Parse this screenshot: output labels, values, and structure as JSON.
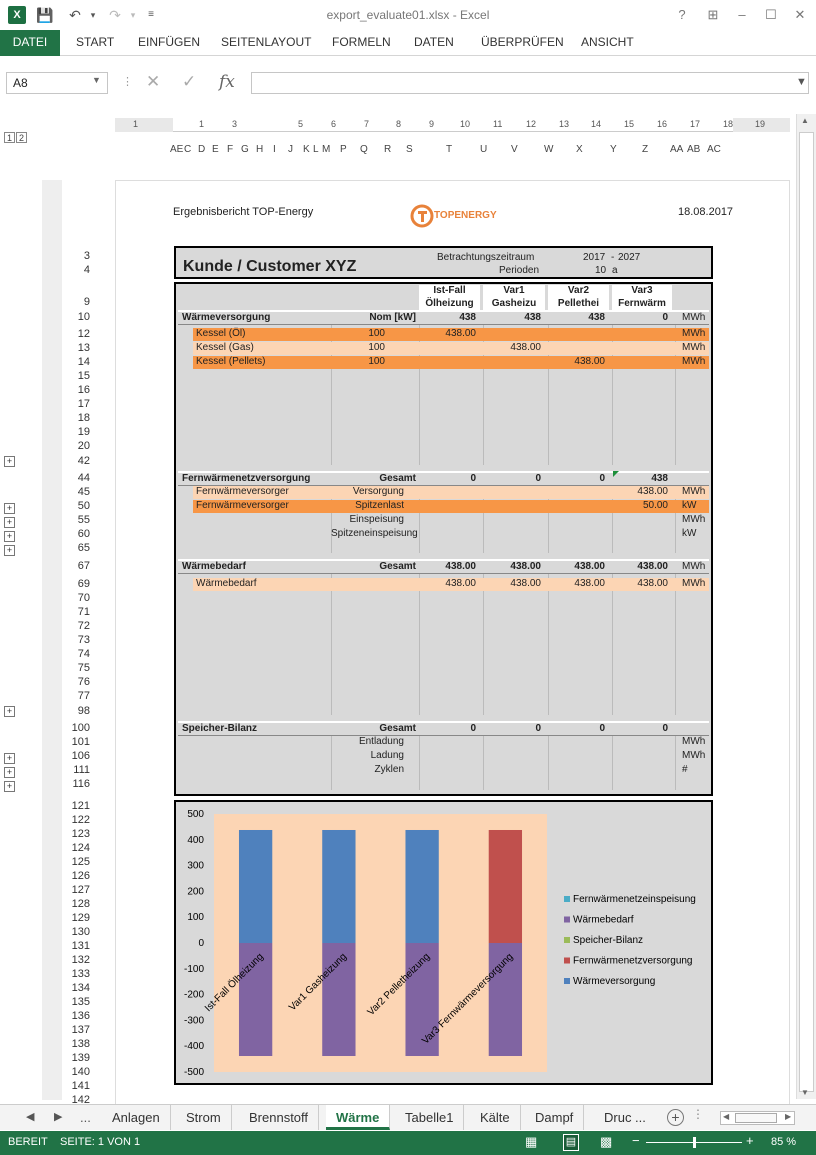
{
  "window": {
    "title": "export_evaluate01.xlsx - Excel",
    "app_icon": "X",
    "help": "?",
    "minimize": "–",
    "restore": "☐",
    "close": "✕"
  },
  "ribbon": {
    "tabs": [
      "DATEI",
      "START",
      "EINFÜGEN",
      "SEITENLAYOUT",
      "FORMELN",
      "DATEN",
      "ÜBERPRÜFEN",
      "ANSICHT"
    ],
    "active_tab": "DATEI"
  },
  "formula_bar": {
    "name_box": "A8",
    "fx_label": "fx",
    "formula": ""
  },
  "outline_levels": [
    "1",
    "2"
  ],
  "ruler": [
    "1",
    "1",
    "3",
    "5",
    "6",
    "7",
    "8",
    "9",
    "10",
    "11",
    "12",
    "13",
    "14",
    "15",
    "16",
    "17",
    "18",
    "19"
  ],
  "columns": [
    "AE",
    "C",
    "D",
    "E",
    "F",
    "G",
    "H",
    "I",
    "J",
    "K",
    "L",
    "M",
    "P",
    "Q",
    "R",
    "S",
    "T",
    "U",
    "V",
    "W",
    "X",
    "Y",
    "Z",
    "AA",
    "AB",
    "AC"
  ],
  "rows": [
    "3",
    "4",
    "9",
    "10",
    "12",
    "13",
    "14",
    "15",
    "16",
    "17",
    "18",
    "19",
    "20",
    "42",
    "44",
    "45",
    "50",
    "55",
    "60",
    "65",
    "67",
    "69",
    "70",
    "71",
    "72",
    "73",
    "74",
    "75",
    "76",
    "77",
    "98",
    "100",
    "101",
    "106",
    "111",
    "116",
    "121",
    "122",
    "123",
    "124",
    "125",
    "126",
    "127",
    "128",
    "129",
    "130",
    "131",
    "132",
    "133",
    "134",
    "135",
    "136",
    "137",
    "138",
    "139",
    "140",
    "141",
    "142"
  ],
  "report": {
    "title": "Ergebnisbericht TOP-Energy",
    "date": "18.08.2017",
    "logo_text": "TOPENERGY",
    "customer": "Kunde / Customer XYZ",
    "period_label": "Betrachtungszeitraum",
    "period_from": "2017",
    "period_sep": "-",
    "period_to": "2027",
    "perioden_label": "Perioden",
    "perioden_value": "10",
    "perioden_unit": "a"
  },
  "table": {
    "variants": [
      {
        "line1": "Ist-Fall",
        "line2": "Ölheizung"
      },
      {
        "line1": "Var1",
        "line2": "Gasheizu"
      },
      {
        "line1": "Var2",
        "line2": "Pellethei"
      },
      {
        "line1": "Var3",
        "line2": "Fernwärm"
      }
    ],
    "sections": [
      {
        "name": "Wärmeversorgung",
        "col_label": "Nom [kW]",
        "totals": [
          "438",
          "438",
          "438",
          "0"
        ],
        "unit": "MWh",
        "rows": [
          {
            "label": "Kessel (Öl)",
            "nom": "100",
            "vals": [
              "438.00",
              "",
              "",
              ""
            ],
            "unit": "MWh"
          },
          {
            "label": "Kessel (Gas)",
            "nom": "100",
            "vals": [
              "",
              "438.00",
              "",
              ""
            ],
            "unit": "MWh"
          },
          {
            "label": "Kessel (Pellets)",
            "nom": "100",
            "vals": [
              "",
              "",
              "438.00",
              ""
            ],
            "unit": "MWh"
          }
        ]
      },
      {
        "name": "Fernwärmenetzversorgung",
        "col_label": "Gesamt",
        "totals": [
          "0",
          "0",
          "0",
          "438"
        ],
        "unit": "",
        "rows": [
          {
            "label": "Fernwärmeversorger",
            "nom": "Versorgung",
            "vals": [
              "",
              "",
              "",
              "438.00"
            ],
            "unit": "MWh"
          },
          {
            "label": "Fernwärmeversorger",
            "nom": "Spitzenlast",
            "vals": [
              "",
              "",
              "",
              "50.00"
            ],
            "unit": "kW"
          },
          {
            "label": "",
            "nom": "Einspeisung",
            "vals": [
              "",
              "",
              "",
              ""
            ],
            "unit": "MWh"
          },
          {
            "label": "",
            "nom": "Spitzeneinspeisung",
            "vals": [
              "",
              "",
              "",
              ""
            ],
            "unit": "kW"
          }
        ]
      },
      {
        "name": "Wärmebedarf",
        "col_label": "Gesamt",
        "totals": [
          "438.00",
          "438.00",
          "438.00",
          "438.00"
        ],
        "unit": "MWh",
        "rows": [
          {
            "label": "Wärmebedarf",
            "nom": "",
            "vals": [
              "438.00",
              "438.00",
              "438.00",
              "438.00"
            ],
            "unit": "MWh"
          }
        ]
      },
      {
        "name": "Speicher-Bilanz",
        "col_label": "Gesamt",
        "totals": [
          "0",
          "0",
          "0",
          "0"
        ],
        "unit": "",
        "rows": [
          {
            "label": "",
            "nom": "Entladung",
            "vals": [
              "",
              "",
              "",
              ""
            ],
            "unit": "MWh"
          },
          {
            "label": "",
            "nom": "Ladung",
            "vals": [
              "",
              "",
              "",
              ""
            ],
            "unit": "MWh"
          },
          {
            "label": "",
            "nom": "Zyklen",
            "vals": [
              "",
              "",
              "",
              ""
            ],
            "unit": "#"
          }
        ]
      }
    ]
  },
  "chart_data": {
    "type": "bar",
    "stacked": true,
    "categories": [
      "Ist-Fall Ölheizung",
      "Var1 Gasheizung",
      "Var2 Pelletheizung",
      "Var3 Fernwärmeversorgung"
    ],
    "series": [
      {
        "name": "Fernwärmenetzeinspeisung",
        "color": "#4bacc6",
        "values": [
          0,
          0,
          0,
          0
        ]
      },
      {
        "name": "Wärmebedarf",
        "color": "#8064a2",
        "values": [
          -438,
          -438,
          -438,
          -438
        ]
      },
      {
        "name": "Speicher-Bilanz",
        "color": "#9bbb59",
        "values": [
          0,
          0,
          0,
          0
        ]
      },
      {
        "name": "Fernwärmenetzversorgung",
        "color": "#c0504d",
        "values": [
          0,
          0,
          0,
          438
        ]
      },
      {
        "name": "Wärmeversorgung",
        "color": "#4f81bd",
        "values": [
          438,
          438,
          438,
          0
        ]
      }
    ],
    "ylim": [
      -500,
      500
    ],
    "yticks": [
      "500",
      "400",
      "300",
      "200",
      "100",
      "0",
      "-100",
      "-200",
      "-300",
      "-400",
      "-500"
    ],
    "legend_position": "right",
    "plot_bg": "#fcd5b4",
    "grid": false
  },
  "sheet_tabs": {
    "tabs": [
      "Anlagen",
      "Strom",
      "Brennstoff",
      "Wärme",
      "Tabelle1",
      "Kälte",
      "Dampf",
      "Druc ..."
    ],
    "active": "Wärme",
    "ellipsis": "...",
    "add": "+"
  },
  "status": {
    "mode": "BEREIT",
    "page": "SEITE: 1 VON 1",
    "zoom_minus": "−",
    "zoom_plus": "+",
    "zoom": "85 %",
    "zoom_fraction": 0.5
  },
  "colors": {
    "excel_green": "#217346",
    "orange_dark": "#f79646",
    "orange_light": "#fcd5b4",
    "panel_grey": "#d9d9d9"
  }
}
